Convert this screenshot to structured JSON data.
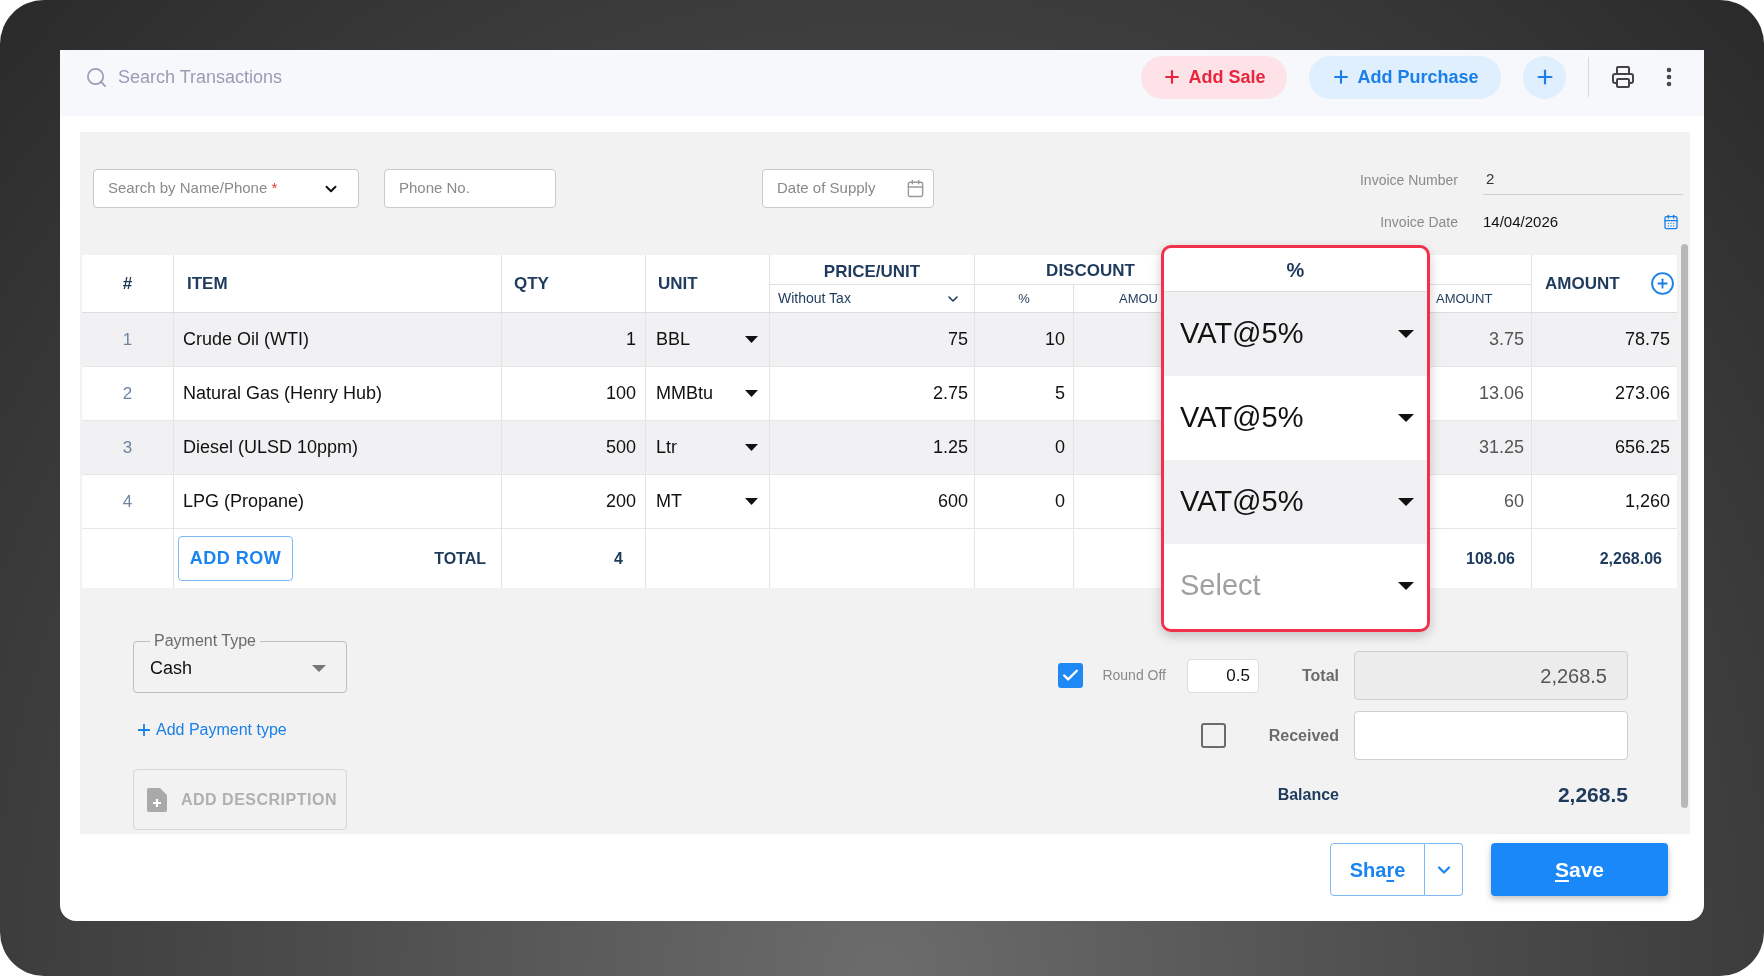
{
  "top_bar": {
    "search": {
      "placeholder": "Search Transactions"
    },
    "actions": [
      {
        "kind": "sale",
        "label": "Add Sale"
      },
      {
        "kind": "purchase",
        "label": "Add Purchase"
      }
    ]
  },
  "party": {
    "name_field": {
      "placeholder": "Search by Name/Phone",
      "required_mark": "*"
    },
    "phone_field": {
      "placeholder": "Phone No."
    },
    "supply_date_field": {
      "placeholder": "Date of Supply"
    }
  },
  "invoice": {
    "number": {
      "label": "Invoice Number",
      "value": "2"
    },
    "date": {
      "label": "Invoice Date",
      "value": "14/04/2026"
    }
  },
  "table": {
    "header": {
      "index": "#",
      "item": "ITEM",
      "qty": "QTY",
      "unit": "UNIT",
      "price": "PRICE/UNIT",
      "price_mode": "Without Tax",
      "discount": "DISCOUNT",
      "discount_percent": "%",
      "discount_amount": "AMOU",
      "tax_amount": "AMOUNT",
      "amount": "AMOUNT"
    },
    "rows": [
      {
        "index": "1",
        "item": "Crude Oil (WTI)",
        "qty": "1",
        "unit": "BBL",
        "price": "75",
        "discount_percent": "10",
        "tax_amount": "3.75",
        "amount": "78.75"
      },
      {
        "index": "2",
        "item": "Natural Gas (Henry Hub)",
        "qty": "100",
        "unit": "MMBtu",
        "price": "2.75",
        "discount_percent": "5",
        "tax_amount": "13.06",
        "amount": "273.06"
      },
      {
        "index": "3",
        "item": "Diesel (ULSD 10ppm)",
        "qty": "500",
        "unit": "Ltr",
        "price": "1.25",
        "discount_percent": "0",
        "tax_amount": "31.25",
        "amount": "656.25"
      },
      {
        "index": "4",
        "item": "LPG (Propane)",
        "qty": "200",
        "unit": "MT",
        "price": "600",
        "discount_percent": "0",
        "tax_amount": "60",
        "amount": "1,260"
      }
    ],
    "add_row_button": "ADD ROW",
    "total": {
      "label": "TOTAL",
      "qty": "4",
      "tax_amount": "108.06",
      "amount": "2,268.06"
    }
  },
  "tax_callout": {
    "header": "%",
    "rows": [
      {
        "value": "VAT@5%"
      },
      {
        "value": "VAT@5%"
      },
      {
        "value": "VAT@5%"
      },
      {
        "placeholder": "Select"
      }
    ]
  },
  "payment": {
    "type_field": {
      "label": "Payment Type",
      "value": "Cash"
    },
    "add_payment_link": "Add Payment type",
    "description_button": {
      "label": "ADD DESCRIPTION",
      "disabled": true
    }
  },
  "summary": {
    "round_off": {
      "label": "Round Off",
      "checked": true,
      "value": "0.5"
    },
    "total": {
      "label": "Total",
      "value": "2,268.5"
    },
    "received": {
      "label": "Received",
      "checked": false
    },
    "balance": {
      "label": "Balance",
      "value": "2,268.5"
    }
  },
  "footer": {
    "share_button": {
      "label": [
        {
          "text": "Sha",
          "underlined": false
        },
        {
          "text": "r",
          "underlined": true
        },
        {
          "text": "e",
          "underlined": false
        }
      ]
    },
    "save_button": {
      "label": [
        {
          "text": "S",
          "underlined": true
        },
        {
          "text": "ave",
          "underlined": false
        }
      ]
    }
  }
}
